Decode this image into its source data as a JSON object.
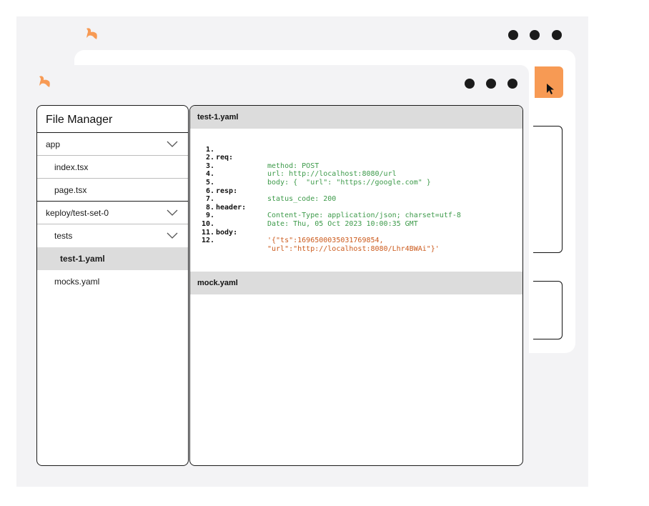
{
  "sidebar": {
    "title": "File Manager",
    "items": [
      {
        "label": "app",
        "indent": 0,
        "expandable": true,
        "active": false
      },
      {
        "label": "index.tsx",
        "indent": 1,
        "expandable": false,
        "active": false
      },
      {
        "label": "page.tsx",
        "indent": 1,
        "expandable": false,
        "active": false
      },
      {
        "label": "keploy/test-set-0",
        "indent": 0,
        "expandable": true,
        "active": false
      },
      {
        "label": "tests",
        "indent": 1,
        "expandable": true,
        "active": false
      },
      {
        "label": "test-1.yaml",
        "indent": 2,
        "expandable": false,
        "active": true
      },
      {
        "label": "mocks.yaml",
        "indent": 1,
        "expandable": false,
        "active": false
      }
    ]
  },
  "editor": {
    "tabs": [
      {
        "label": "test-1.yaml"
      },
      {
        "label": "mock.yaml"
      }
    ],
    "lines": [
      {
        "num": "1.",
        "key": "req:",
        "value": ""
      },
      {
        "num": "2.",
        "key": "",
        "value": "method: POST"
      },
      {
        "num": "3.",
        "key": "",
        "value": "url: http://localhost:8080/url"
      },
      {
        "num": "4.",
        "key": "",
        "value": "body: {  \"url\": \"https://google.com\" }"
      },
      {
        "num": "5.",
        "key": "resp:",
        "value": ""
      },
      {
        "num": "6.",
        "key": "",
        "value": "status_code: 200"
      },
      {
        "num": "7.",
        "key": "header:",
        "value": ""
      },
      {
        "num": "8.",
        "key": "",
        "value": "Content-Type: application/json; charset=utf-8"
      },
      {
        "num": "9.",
        "key": "",
        "value": "Date: Thu, 05 Oct 2023 10:00:35 GMT"
      },
      {
        "num": "10.",
        "key": "body:",
        "value": ""
      },
      {
        "num": "11.",
        "key": "",
        "value": "'{\"ts\":1696500035031769854,"
      },
      {
        "num": "12.",
        "key": "",
        "value": "\"url\":\"http://localhost:8080/Lhr4BWAi\"}'"
      }
    ]
  },
  "icons": {
    "logo": "keploy-bunny-logo",
    "window_dots": "more-dots-icon",
    "cursor": "mouse-cursor-icon",
    "chevron": "chevron-down-icon"
  },
  "colors": {
    "accent": "#f79a54",
    "green": "#3d9a4a",
    "orange_text": "#cc5a1c",
    "blue": "#2a61c0",
    "active_row": "#dcdcdc",
    "tab_header": "#dcdcdc"
  }
}
